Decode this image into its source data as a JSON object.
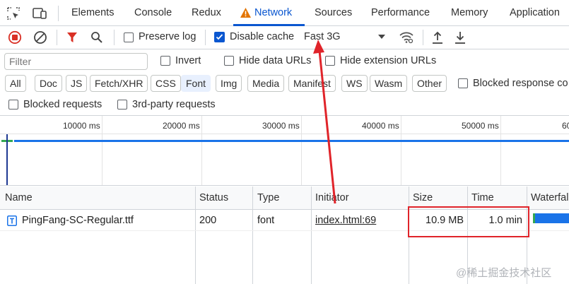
{
  "tabs": [
    {
      "label": "Elements"
    },
    {
      "label": "Console"
    },
    {
      "label": "Redux"
    },
    {
      "label": "Network",
      "active": true,
      "warning_icon": "warning-icon"
    },
    {
      "label": "Sources"
    },
    {
      "label": "Performance"
    },
    {
      "label": "Memory"
    },
    {
      "label": "Application"
    }
  ],
  "toolbar": {
    "preserve_log_label": "Preserve log",
    "preserve_log_checked": false,
    "disable_cache_label": "Disable cache",
    "disable_cache_checked": true,
    "throttle_value": "Fast 3G"
  },
  "filter": {
    "placeholder": "Filter",
    "invert_label": "Invert",
    "hide_data_urls_label": "Hide data URLs",
    "hide_extension_urls_label": "Hide extension URLs"
  },
  "chips": [
    "All",
    "Doc",
    "JS",
    "Fetch/XHR",
    "CSS",
    "Font",
    "Img",
    "Media",
    "Manifest",
    "WS",
    "Wasm",
    "Other"
  ],
  "active_chip": "Font",
  "blocked_response_label": "Blocked response co",
  "blocked_requests_label": "Blocked requests",
  "third_party_label": "3rd-party requests",
  "overview": {
    "ticks": [
      "10000 ms",
      "20000 ms",
      "30000 ms",
      "40000 ms",
      "50000 ms",
      "60"
    ]
  },
  "table": {
    "headers": [
      "Name",
      "Status",
      "Type",
      "Initiator",
      "Size",
      "Time",
      "Waterfal"
    ],
    "rows": [
      {
        "name": "PingFang-SC-Regular.ttf",
        "status": "200",
        "type": "font",
        "initiator": "index.html:69",
        "size": "10.9 MB",
        "time": "1.0 min"
      }
    ]
  },
  "colors": {
    "accent": "#0b57d0",
    "record_red": "#d93025",
    "annotation_red": "#e0242a",
    "waterfall_blue": "#1a73e8",
    "waterfall_green": "#34a853"
  },
  "watermark": "@稀土掘金技术社区"
}
